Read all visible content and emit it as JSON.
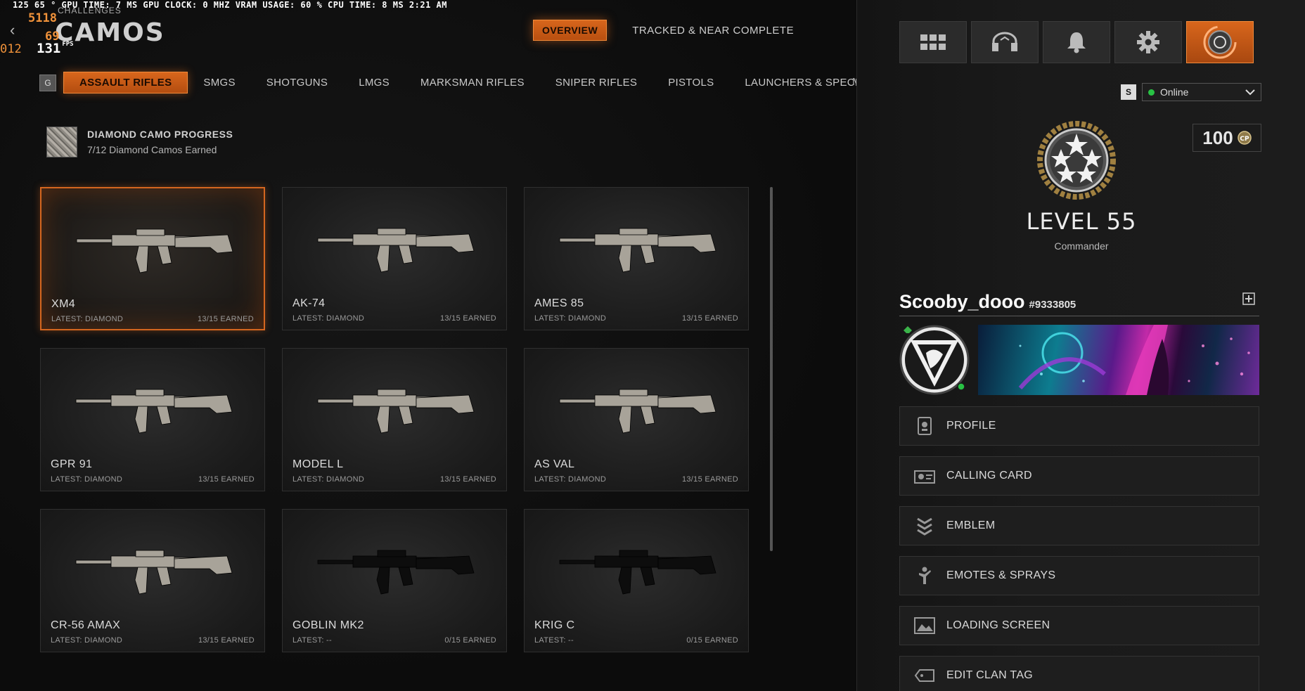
{
  "overlay": {
    "perf_bar": "125  65 °  GPU TIME:  7 MS  GPU CLOCK: 0 MHZ  VRAM USAGE: 60 %  CPU TIME:  8 MS  2:21 AM",
    "o1": "5118",
    "o2": "69",
    "o3": "012",
    "fps": "131",
    "fps_unit": "FPS"
  },
  "page": {
    "title": "CAMOS",
    "subtitle": "CHALLENGES"
  },
  "top_tabs": [
    {
      "label": "OVERVIEW",
      "active": true
    },
    {
      "label": "TRACKED & NEAR COMPLETE",
      "active": false
    }
  ],
  "categories": {
    "prev_key": "G",
    "items": [
      "ASSAULT RIFLES",
      "SMGS",
      "SHOTGUNS",
      "LMGS",
      "MARKSMAN RIFLES",
      "SNIPER RIFLES",
      "PISTOLS",
      "LAUNCHERS & SPECIALS"
    ],
    "active_index": 0,
    "cut_off": "M"
  },
  "progress": {
    "title": "DIAMOND CAMO PROGRESS",
    "subtitle": "7/12 Diamond Camos Earned"
  },
  "weapons": [
    {
      "name": "XM4",
      "latest": "LATEST: DIAMOND",
      "earned": "13/15 EARNED",
      "camo": "diamond",
      "selected": true
    },
    {
      "name": "AK-74",
      "latest": "LATEST: DIAMOND",
      "earned": "13/15 EARNED",
      "camo": "diamond",
      "selected": false
    },
    {
      "name": "AMES 85",
      "latest": "LATEST: DIAMOND",
      "earned": "13/15 EARNED",
      "camo": "diamond",
      "selected": false
    },
    {
      "name": "GPR 91",
      "latest": "LATEST: DIAMOND",
      "earned": "13/15 EARNED",
      "camo": "diamond",
      "selected": false
    },
    {
      "name": "MODEL L",
      "latest": "LATEST: DIAMOND",
      "earned": "13/15 EARNED",
      "camo": "diamond",
      "selected": false
    },
    {
      "name": "AS VAL",
      "latest": "LATEST: DIAMOND",
      "earned": "13/15 EARNED",
      "camo": "diamond",
      "selected": false
    },
    {
      "name": "CR-56 AMAX",
      "latest": "LATEST: DIAMOND",
      "earned": "13/15 EARNED",
      "camo": "diamond",
      "selected": false
    },
    {
      "name": "GOBLIN MK2",
      "latest": "LATEST: --",
      "earned": "0/15 EARNED",
      "camo": "none",
      "selected": false
    },
    {
      "name": "KRIG C",
      "latest": "LATEST: --",
      "earned": "0/15 EARNED",
      "camo": "none",
      "selected": false
    }
  ],
  "panel": {
    "icons": [
      "grid-menu-icon",
      "headset-icon",
      "bell-icon",
      "gear-icon",
      "profile-ring-icon"
    ],
    "status_key": "S",
    "status": "Online",
    "points": "100",
    "level": "LEVEL 55",
    "rank": "Commander",
    "gamertag": "Scooby_dooo",
    "gamer_id": "#9333805",
    "menu": [
      {
        "label": "PROFILE",
        "icon": "profile-card-icon"
      },
      {
        "label": "CALLING CARD",
        "icon": "calling-card-icon"
      },
      {
        "label": "EMBLEM",
        "icon": "emblem-icon"
      },
      {
        "label": "EMOTES & SPRAYS",
        "icon": "emote-icon"
      },
      {
        "label": "LOADING SCREEN",
        "icon": "loading-screen-icon"
      },
      {
        "label": "EDIT CLAN TAG",
        "icon": "clan-tag-icon"
      }
    ]
  },
  "colors": {
    "accent": "#d4661f",
    "online": "#28c244",
    "diamond_camo": "#a8a399"
  }
}
